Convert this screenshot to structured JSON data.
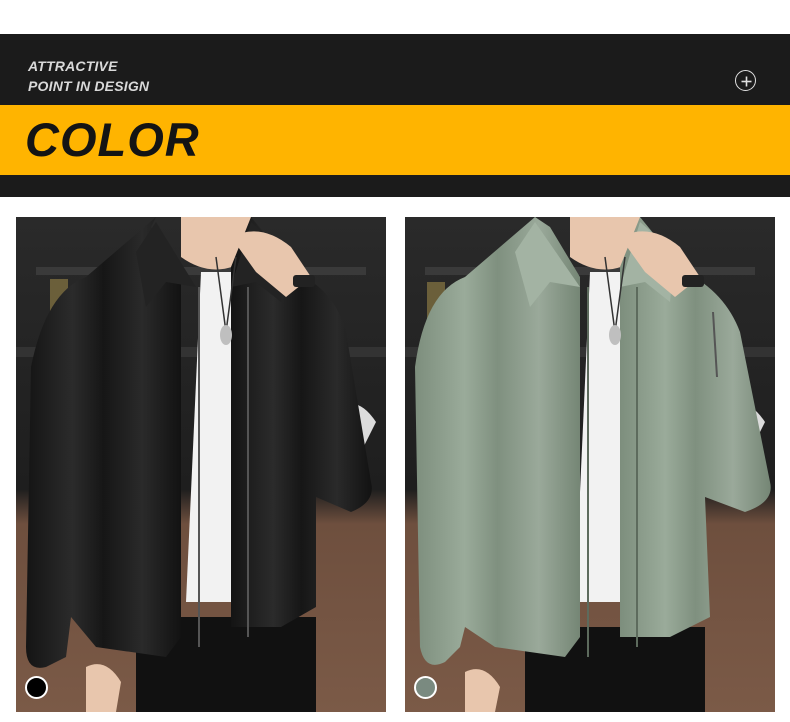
{
  "header": {
    "tagline_line1": "ATTRACTIVE",
    "tagline_line2": "POINT IN DESIGN",
    "title": "COLOR",
    "accent_color": "#ffb400",
    "icon": "plus-circle-icon"
  },
  "variants": [
    {
      "name": "black",
      "swatch_color": "#000000",
      "jacket_color": "#1a1a1a"
    },
    {
      "name": "sage-green",
      "swatch_color": "#7a8a80",
      "jacket_color": "#8fa08f"
    }
  ]
}
